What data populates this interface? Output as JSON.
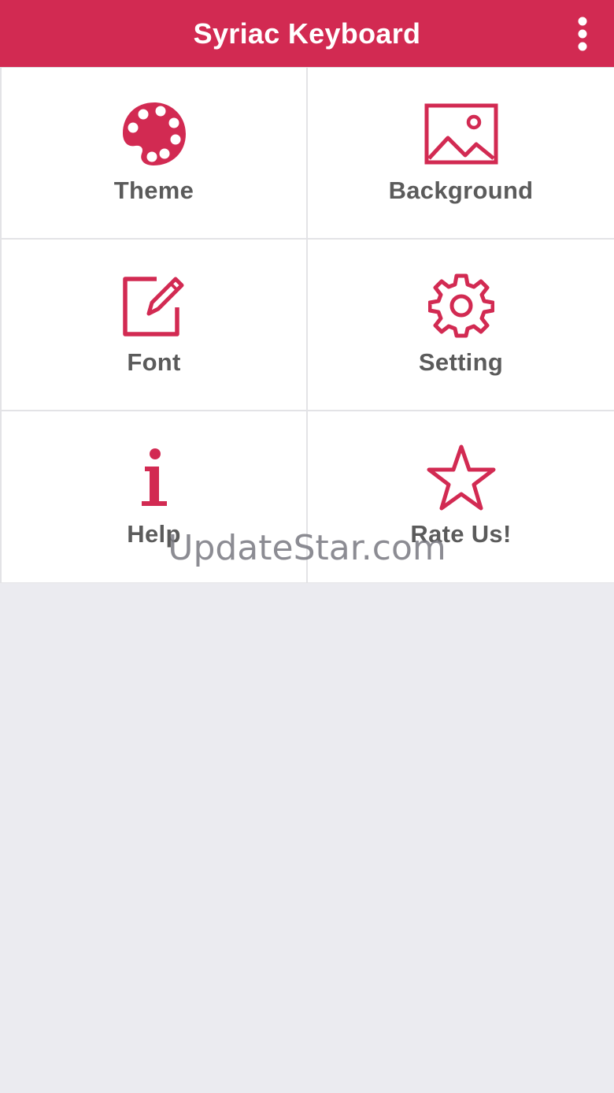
{
  "app_bar": {
    "title": "Syriac Keyboard",
    "menu_icon": "more-vertical-icon",
    "background_color": "#d22a52"
  },
  "menu": {
    "tiles": [
      {
        "label": "Theme",
        "icon": "palette-icon"
      },
      {
        "label": "Background",
        "icon": "image-icon"
      },
      {
        "label": "Font",
        "icon": "edit-icon"
      },
      {
        "label": "Setting",
        "icon": "gear-icon"
      },
      {
        "label": "Help",
        "icon": "info-icon"
      },
      {
        "label": "Rate Us!",
        "icon": "star-icon"
      }
    ],
    "icon_color": "#d22a52",
    "label_color": "#5b5b5b"
  },
  "watermark": {
    "text": "UpdateStar.com"
  }
}
